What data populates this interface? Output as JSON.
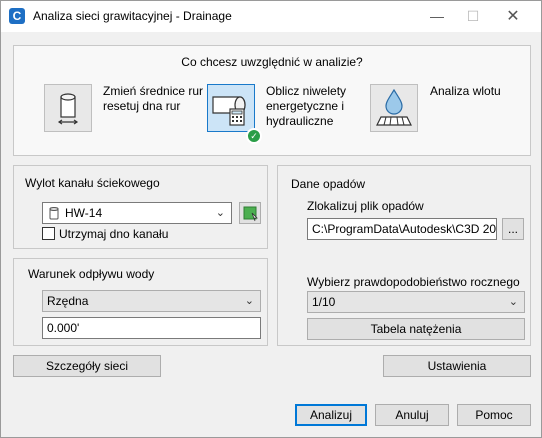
{
  "window": {
    "title": "Analiza sieci grawitacyjnej - Drainage",
    "app_icon": "civil3d-app-icon"
  },
  "analysis": {
    "question": "Co chcesz uwzględnić w analizie?",
    "options": [
      {
        "label_line1": "Zmień średnice rur i",
        "label_line2": "resetuj dna rur",
        "label_line3": "",
        "icon": "pipe-diameter-icon",
        "selected": false
      },
      {
        "label_line1": "Oblicz niwelety",
        "label_line2": "energetyczne i",
        "label_line3": "hydrauliczne",
        "icon": "pipe-calculator-icon",
        "selected": true
      },
      {
        "label_line1": "Analiza wlotu",
        "label_line2": "",
        "label_line3": "",
        "icon": "inlet-water-drop-icon",
        "selected": false
      }
    ]
  },
  "outlet": {
    "group_label": "Wylot kanału ściekowego",
    "structure_value": "HW-14",
    "hold_invert_label": "Utrzymaj dno kanału",
    "hold_invert_checked": false
  },
  "tailwater": {
    "group_label": "Warunek odpływu wody",
    "condition_value": "Rzędna",
    "elevation_value": "0.000'"
  },
  "rainfall": {
    "group_label": "Dane opadów",
    "locate_label": "Zlokalizuj plik opadów",
    "file_path": "C:\\ProgramData\\Autodesk\\C3D 2021\\",
    "browse_label": "...",
    "probability_label": "Wybierz prawdopodobieństwo rocznego",
    "probability_value": "1/10",
    "intensity_button": "Tabela natężenia"
  },
  "footer": {
    "network_details": "Szczegóły sieci",
    "settings": "Ustawienia",
    "analyze": "Analizuj",
    "cancel": "Anuluj",
    "help": "Pomoc"
  },
  "colors": {
    "accent": "#0078d7",
    "selected_bg": "#cce4f7",
    "check_green": "#2a9d47"
  }
}
